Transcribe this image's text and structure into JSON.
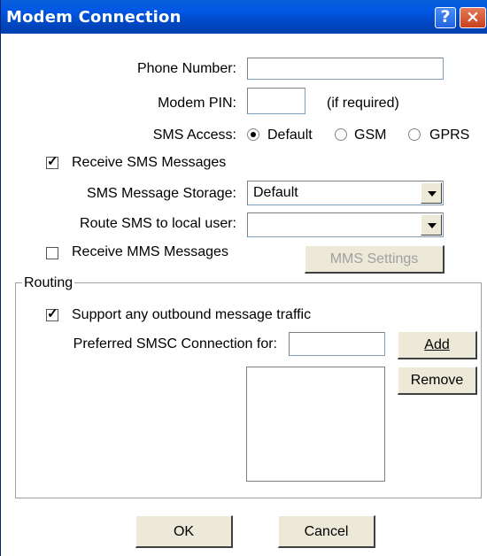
{
  "window": {
    "title": "Modem Connection",
    "help_icon": "?",
    "close_icon": "×"
  },
  "phone": {
    "label": "Phone Number:",
    "value": ""
  },
  "modem_pin": {
    "label": "Modem PIN:",
    "value": "",
    "hint": "(if required)"
  },
  "sms_access": {
    "label": "SMS Access:",
    "options": [
      "Default",
      "GSM",
      "GPRS"
    ],
    "selected": "Default"
  },
  "receive_sms": {
    "label": "Receive SMS Messages",
    "checked": true
  },
  "sms_storage": {
    "label": "SMS Message Storage:",
    "value": "Default"
  },
  "route_sms": {
    "label": "Route SMS to local user:",
    "value": ""
  },
  "receive_mms": {
    "label": "Receive MMS Messages",
    "checked": false
  },
  "mms_settings": {
    "label": "MMS Settings"
  },
  "routing": {
    "title": "Routing",
    "support_outbound": {
      "label": "Support any outbound message traffic",
      "checked": true
    },
    "preferred_smsc": {
      "label": "Preferred SMSC Connection for:",
      "value": ""
    },
    "add_label": "Add",
    "remove_label": "Remove"
  },
  "footer": {
    "ok_label": "OK",
    "cancel_label": "Cancel"
  }
}
